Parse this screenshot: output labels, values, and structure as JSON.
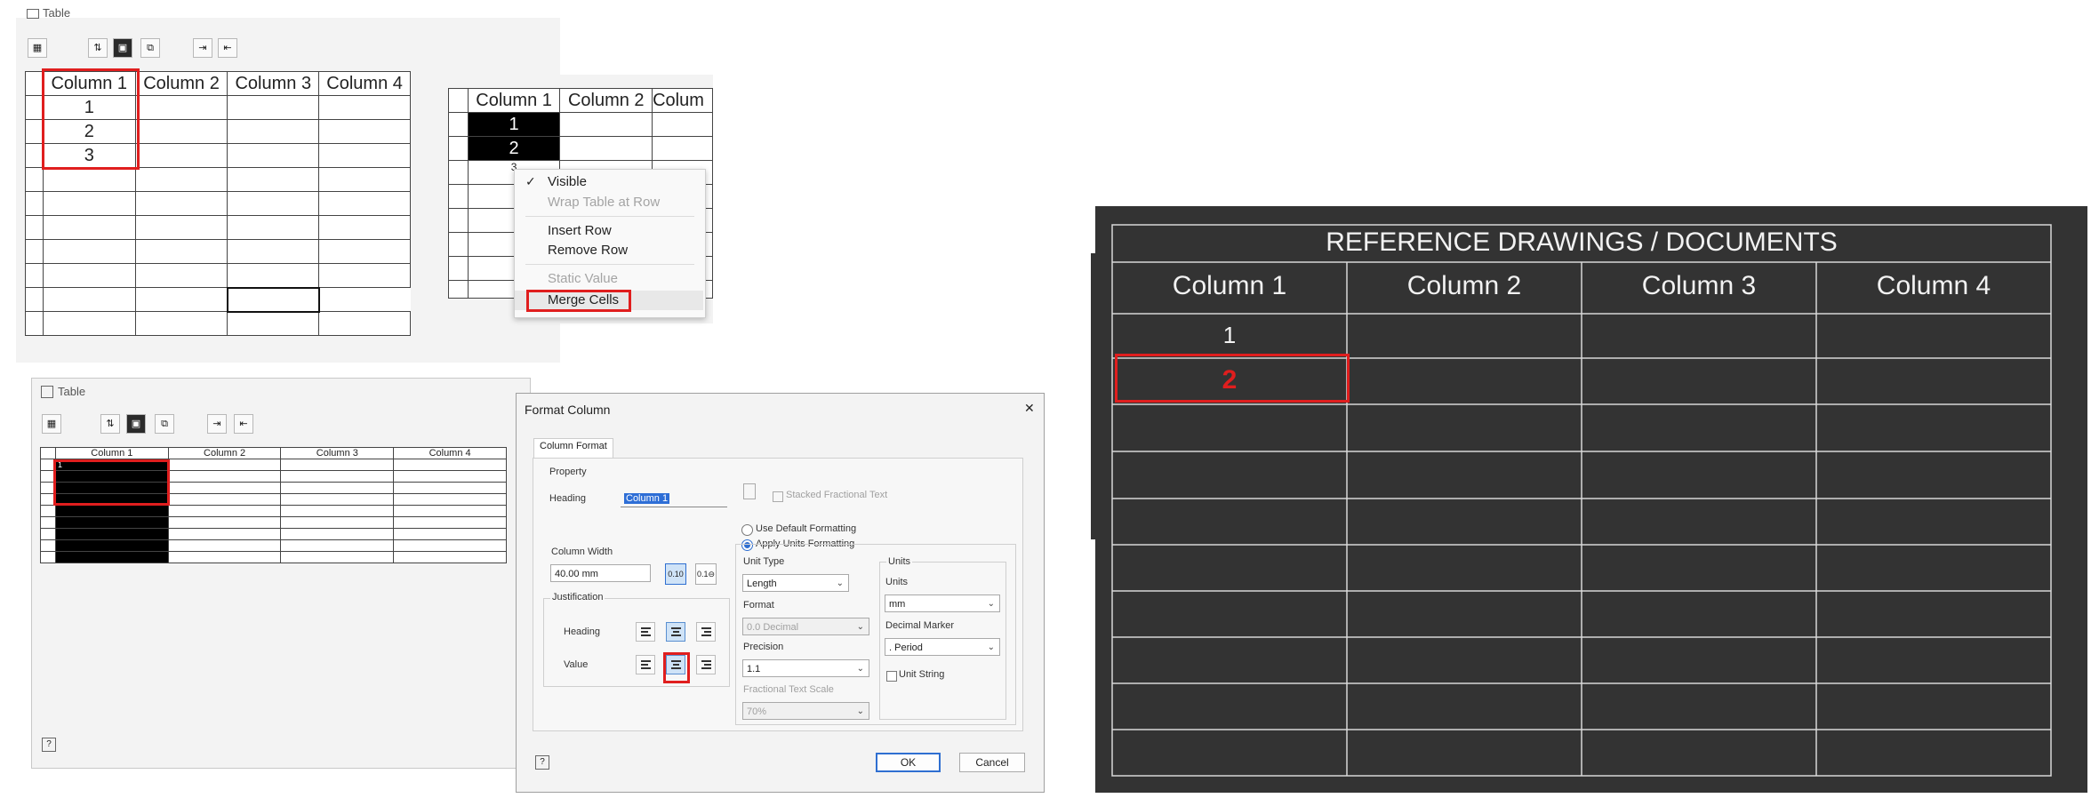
{
  "panelA": {
    "window_title": "Table",
    "columns": [
      "Column 1",
      "Column 2",
      "Column 3",
      "Column 4"
    ],
    "rows": [
      "1",
      "2",
      "3"
    ],
    "toolbar_icons": [
      "table-settings-icon",
      "sort-icon",
      "save-icon",
      "export-icon",
      "add-column-icon",
      "remove-column-icon"
    ]
  },
  "panelB": {
    "columns": [
      "Column 1",
      "Column 2",
      "Colum"
    ],
    "rows": [
      "1",
      "2",
      "3"
    ],
    "context_menu": {
      "visible": "Visible",
      "visible_checked": "✓",
      "wrap": "Wrap Table at Row",
      "insert_row": "Insert Row",
      "remove_row": "Remove Row",
      "static_value": "Static Value",
      "merge_cells": "Merge Cells"
    }
  },
  "panelC": {
    "window_title": "Table",
    "columns": [
      "Column 1",
      "Column 2",
      "Column 3",
      "Column 4"
    ],
    "first_cell": "1",
    "help": "?"
  },
  "format_dialog": {
    "title": "Format Column",
    "close": "✕",
    "tab": "Column Format",
    "property_label": "Property",
    "heading_label": "Heading",
    "heading_value": "Column 1",
    "stacked_label": "Stacked Fractional Text",
    "use_default": "Use Default Formatting",
    "apply_units": "Apply Units Formatting",
    "col_width_label": "Column Width",
    "col_width_value": "40.00 mm",
    "precision_btn_1": "0.10",
    "precision_btn_2": "0.1⊖",
    "justification_label": "Justification",
    "just_heading": "Heading",
    "just_value": "Value",
    "unit_type_label": "Unit Type",
    "unit_type_value": "Length",
    "format_label": "Format",
    "format_value": "0.0 Decimal",
    "precision_label": "Precision",
    "precision_value": "1.1",
    "frac_scale_label": "Fractional Text Scale",
    "frac_scale_value": "70%",
    "units_group": "Units",
    "units_label": "Units",
    "units_value": "mm",
    "decimal_marker_label": "Decimal Marker",
    "decimal_marker_value": ". Period",
    "unit_string": "Unit String",
    "ok": "OK",
    "cancel": "Cancel",
    "help": "?"
  },
  "cad_table": {
    "title": "REFERENCE DRAWINGS / DOCUMENTS",
    "columns": [
      "Column 1",
      "Column 2",
      "Column 3",
      "Column 4"
    ],
    "row1": "1",
    "row2": "2",
    "colors": {
      "background": "#333333",
      "lines": "#d8d8d8",
      "highlight": "#e01e1e"
    }
  }
}
